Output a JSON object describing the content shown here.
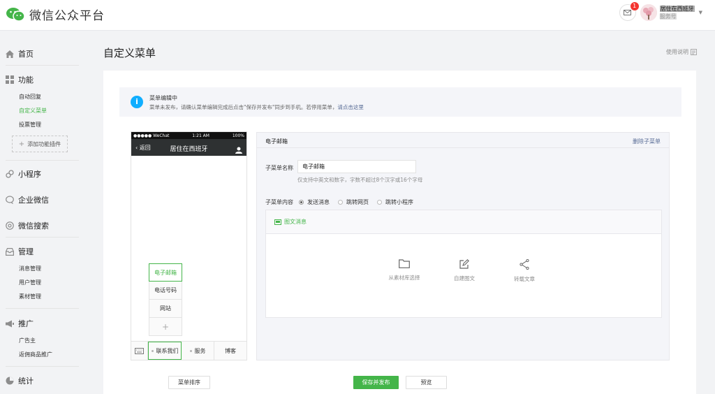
{
  "header": {
    "logo_text": "微信公众平台",
    "mail_badge": "1",
    "account_name": "居住在西班牙",
    "account_type": "服务号"
  },
  "sidebar": {
    "home": "首页",
    "features": "功能",
    "features_items": [
      "自动回复",
      "自定义菜单",
      "投票管理"
    ],
    "add_plugin": "添加功能插件",
    "mini_program": "小程序",
    "enterprise": "企业微信",
    "search": "微信搜索",
    "manage": "管理",
    "manage_items": [
      "消息管理",
      "用户管理",
      "素材管理"
    ],
    "promote": "推广",
    "promote_items": [
      "广告主",
      "返佣商品推广"
    ],
    "stats": "统计"
  },
  "page": {
    "title": "自定义菜单",
    "help": "使用说明"
  },
  "notice": {
    "title": "菜单编辑中",
    "text": "菜单未发布，请确认菜单编辑完成后点击\"保存并发布\"同步到手机。若停用菜单，",
    "link": "请点击这里"
  },
  "phone": {
    "carrier": "●●●●● WeChat",
    "time": "1:21 AM",
    "battery": "100%",
    "back": "返回",
    "title": "居住在西班牙",
    "submenu": [
      "电子邮箱",
      "电话号码",
      "网站"
    ],
    "plus": "+",
    "tabs": [
      "联系我们",
      "服务",
      "博客"
    ]
  },
  "editor": {
    "title": "电子邮箱",
    "delete": "删除子菜单",
    "name_label": "子菜单名称",
    "name_value": "电子邮箱",
    "hint": "仅支持中英文和数字，字数不超过8个汉字或16个字母",
    "content_label": "子菜单内容",
    "radio_options": [
      "发送消息",
      "跳转网页",
      "跳转小程序"
    ],
    "tab_label": "图文消息",
    "options": [
      "从素材库选择",
      "自建图文",
      "转载文章"
    ]
  },
  "buttons": {
    "sort": "菜单排序",
    "save": "保存并发布",
    "preview": "预览"
  },
  "colors": {
    "accent_green": "#44b549",
    "link_blue": "#576b95",
    "info_blue": "#10aeff",
    "badge_red": "#f43530"
  }
}
